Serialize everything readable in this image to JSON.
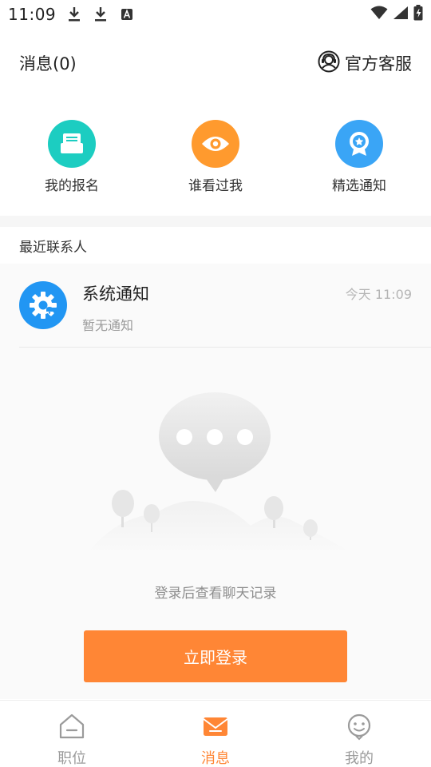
{
  "status_bar": {
    "time": "11:09",
    "icons": [
      "download-icon",
      "download-icon",
      "text-a-icon",
      "wifi-icon",
      "signal-icon",
      "battery-charging-icon"
    ]
  },
  "header": {
    "title": "消息(0)",
    "service_label": "官方客服",
    "service_icon": "headset-icon"
  },
  "shortcuts": [
    {
      "label": "我的报名",
      "icon": "signup-icon",
      "color": "#1ccdc1"
    },
    {
      "label": "谁看过我",
      "icon": "eye-icon",
      "color": "#ff9a2e"
    },
    {
      "label": "精选通知",
      "icon": "badge-star-icon",
      "color": "#3aa5f6"
    }
  ],
  "recent": {
    "section_title": "最近联系人",
    "item": {
      "name": "系统通知",
      "time": "今天 11:09",
      "preview": "暂无通知",
      "icon": "gear-icon",
      "avatar_color": "#2196f3"
    }
  },
  "empty_state": {
    "message": "登录后查看聊天记录",
    "illustration": "chat-bubble-illustration"
  },
  "login_button": {
    "label": "立即登录",
    "color": "#ff8635"
  },
  "bottom_nav": {
    "items": [
      {
        "label": "职位",
        "icon": "home-icon"
      },
      {
        "label": "消息",
        "icon": "mail-icon"
      },
      {
        "label": "我的",
        "icon": "smile-icon"
      }
    ],
    "active_index": 1,
    "active_color": "#ff8635"
  }
}
